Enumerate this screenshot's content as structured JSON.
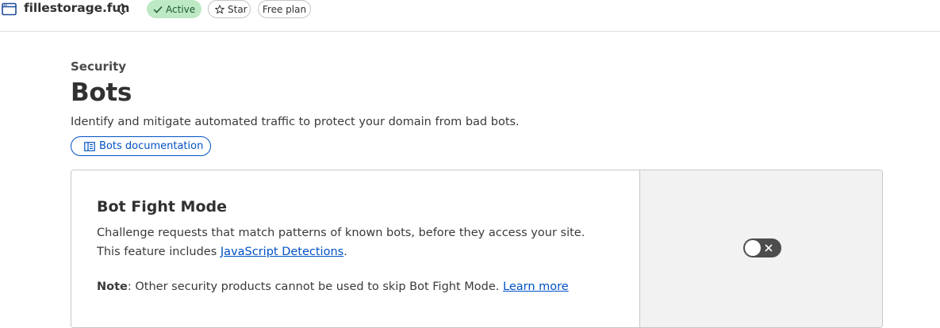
{
  "header": {
    "site_name": "fillestorage.fun",
    "status_label": "Active",
    "star_label": "Star",
    "plan_label": "Free plan"
  },
  "page": {
    "breadcrumb": "Security",
    "title": "Bots",
    "description": "Identify and mitigate automated traffic to protect your domain from bad bots.",
    "doc_button_label": "Bots documentation"
  },
  "bot_fight_mode": {
    "title": "Bot Fight Mode",
    "description_prefix": "Challenge requests that match patterns of known bots, before they access your site. This feature includes ",
    "description_link": "JavaScript Detections",
    "description_suffix": ".",
    "note_label": "Note",
    "note_text": ": Other security products cannot be used to skip Bot Fight Mode. ",
    "learn_more_label": "Learn more",
    "toggle_state": "off"
  },
  "colors": {
    "link": "#0051c3",
    "active_pill_bg": "#bde9c4",
    "toggle_off": "#4d4d4d"
  }
}
